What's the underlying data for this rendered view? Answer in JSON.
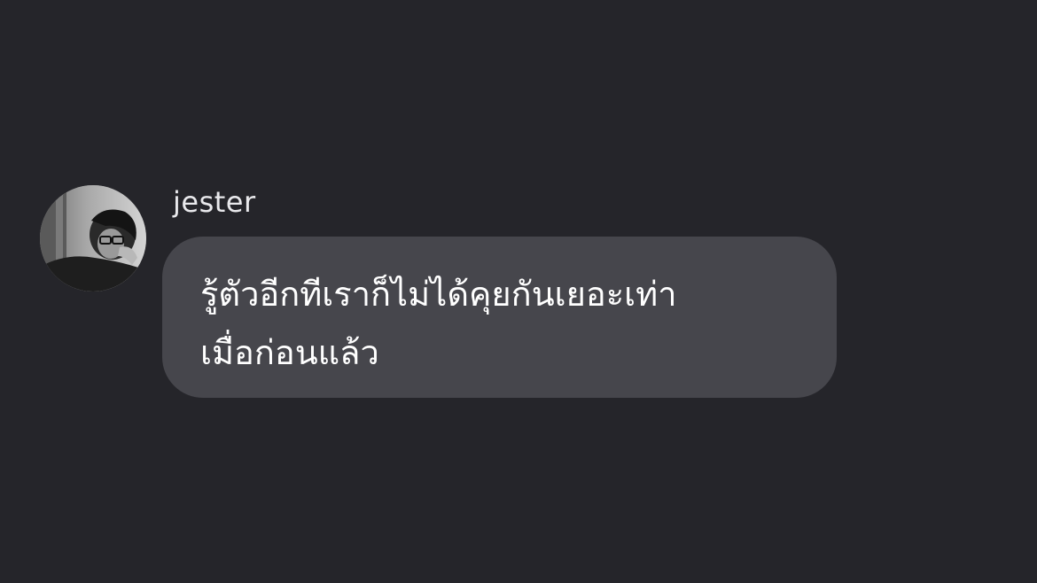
{
  "message": {
    "sender": "jester",
    "avatar_icon": "profile-photo-icon",
    "text": "รู้ตัวอีกทีเราก็ไม่ได้คุยกันเยอะเท่า\nเมื่อก่อนแล้ว"
  },
  "colors": {
    "background": "#25252a",
    "bubble": "#46464c",
    "text": "#ffffff"
  }
}
